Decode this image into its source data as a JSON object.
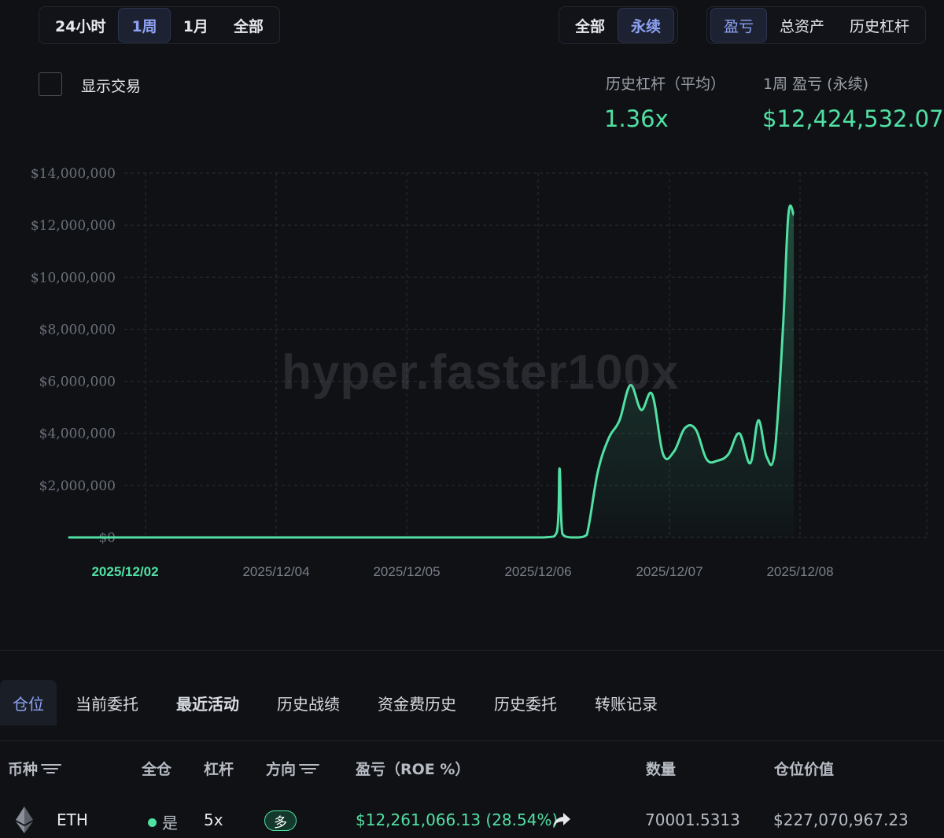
{
  "range_tabs": [
    {
      "label": "24小时",
      "active": false
    },
    {
      "label": "1周",
      "active": true
    },
    {
      "label": "1月",
      "active": false
    },
    {
      "label": "全部",
      "active": false
    }
  ],
  "market_tabs": [
    {
      "label": "全部",
      "active": false
    },
    {
      "label": "永续",
      "active": true
    }
  ],
  "metric_tabs": [
    {
      "label": "盈亏",
      "active": true
    },
    {
      "label": "总资产",
      "active": false
    },
    {
      "label": "历史杠杆",
      "active": false
    }
  ],
  "show_trades": {
    "label": "显示交易",
    "checked": false
  },
  "stats": {
    "leverage_label": "历史杠杆（平均）",
    "leverage_value": "1.36x",
    "pnl_label": "1周 盈亏 (永续)",
    "pnl_value": "$12,424,532.07"
  },
  "watermark": "hyper.faster100x",
  "colors": {
    "accent": "#51e0a3",
    "active_tab": "#8ea2f5",
    "background": "#0f1115"
  },
  "chart_data": {
    "type": "area",
    "x_ticks": [
      "2025/12/02",
      "2025/12/04",
      "2025/12/05",
      "2025/12/06",
      "2025/12/07",
      "2025/12/08"
    ],
    "highlighted_tick": "2025/12/02",
    "y_ticks": [
      "$14,000,000",
      "$12,000,000",
      "$10,000,000",
      "$8,000,000",
      "$6,000,000",
      "$4,000,000",
      "$2,000,000",
      "$0"
    ],
    "ylim": [
      0,
      14000000
    ],
    "grid": true,
    "x": [
      "2025/12/02",
      "2025/12/03 12:00",
      "2025/12/05 12:00",
      "2025/12/06 14:00",
      "2025/12/07 01:00",
      "2025/12/07 03:30",
      "2025/12/07 04:00",
      "2025/12/07 04:30",
      "2025/12/07 06:00",
      "2025/12/07 07:30",
      "2025/12/07 09:00",
      "2025/12/07 11:00",
      "2025/12/07 13:00",
      "2025/12/07 15:00",
      "2025/12/07 17:00",
      "2025/12/07 19:00",
      "2025/12/07 21:00",
      "2025/12/07 23:00",
      "2025/12/08 01:00",
      "2025/12/08 03:00",
      "2025/12/08 05:00",
      "2025/12/08 07:00",
      "2025/12/08 09:00",
      "2025/12/08 11:00",
      "2025/12/08 13:00",
      "2025/12/08 15:00",
      "2025/12/08 16:30",
      "2025/12/08 18:00",
      "2025/12/08 19:30",
      "2025/12/08 21:00",
      "2025/12/08 22:00",
      "2025/12/08 23:00"
    ],
    "values": [
      0,
      0,
      0,
      0,
      0,
      200000,
      2650000,
      150000,
      0,
      0,
      100000,
      2500000,
      3800000,
      4500000,
      5850000,
      4900000,
      5500000,
      3200000,
      3300000,
      4200000,
      4150000,
      3000000,
      2950000,
      3200000,
      4000000,
      2850000,
      4500000,
      3100000,
      3300000,
      8000000,
      12400000,
      12400000
    ]
  },
  "bottom_tabs": [
    {
      "label": "仓位",
      "active": true,
      "bold": false
    },
    {
      "label": "当前委托",
      "active": false,
      "bold": false
    },
    {
      "label": "最近活动",
      "active": false,
      "bold": true
    },
    {
      "label": "历史战绩",
      "active": false,
      "bold": false
    },
    {
      "label": "资金费历史",
      "active": false,
      "bold": false
    },
    {
      "label": "历史委托",
      "active": false,
      "bold": false
    },
    {
      "label": "转账记录",
      "active": false,
      "bold": false
    }
  ],
  "table": {
    "headers": {
      "coin": "币种",
      "cross": "全仓",
      "leverage": "杠杆",
      "side": "方向",
      "pnl": "盈亏（ROE %）",
      "size": "数量",
      "value": "仓位价值"
    },
    "rows": [
      {
        "coin": "ETH",
        "cross": "是",
        "leverage": "5x",
        "side": "多",
        "pnl": "$12,261,066.13 (28.54%)",
        "size": "70001.5313",
        "value": "$227,070,967.23"
      }
    ]
  }
}
